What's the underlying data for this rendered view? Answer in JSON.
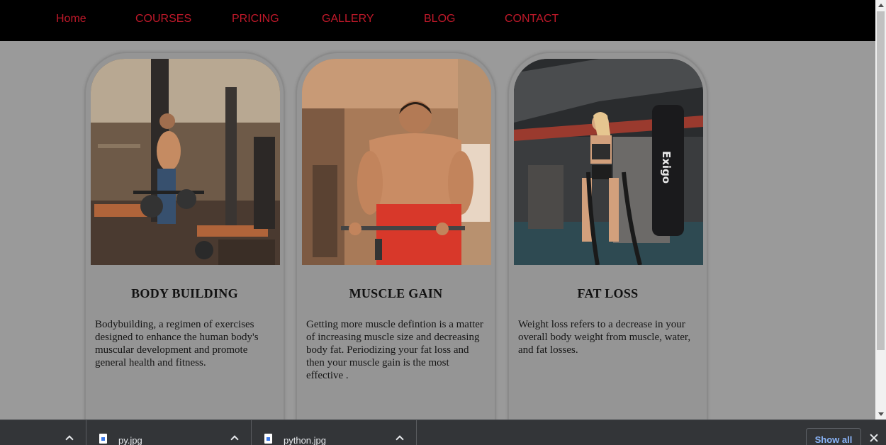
{
  "nav": {
    "items": [
      {
        "label": "Home"
      },
      {
        "label": "COURSES"
      },
      {
        "label": "PRICING"
      },
      {
        "label": "GALLERY"
      },
      {
        "label": "BLOG"
      },
      {
        "label": "CONTACT"
      }
    ],
    "color": "#c0192a"
  },
  "cards": [
    {
      "title": "BODY BUILDING",
      "text": "Bodybuilding, a regimen of exercises designed to enhance the human body's muscular development and promote general health and fitness.",
      "image": "gym-bodybuilder-photo"
    },
    {
      "title": "MUSCLE GAIN",
      "text": "Getting more muscle defintion is a matter of increasing muscle size and decreasing body fat. Periodizing your fat loss and then your muscle gain is the most effective .",
      "image": "muscle-man-curling-photo"
    },
    {
      "title": "FAT LOSS",
      "text": "Weight loss refers to a decrease in your overall body weight from muscle, water, and fat losses.",
      "image": "woman-battle-ropes-photo"
    }
  ],
  "downloads": {
    "items": [
      {
        "name": "py.jpg"
      },
      {
        "name": "python.jpg"
      }
    ],
    "show_all": "Show all"
  }
}
